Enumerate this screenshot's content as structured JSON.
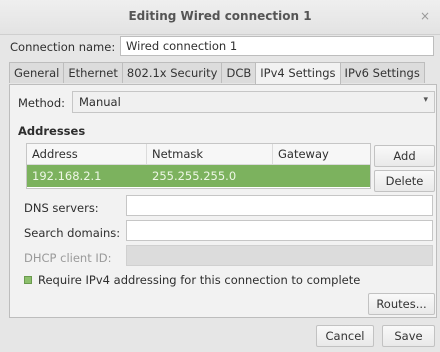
{
  "window": {
    "title": "Editing Wired connection 1",
    "close_glyph": "×"
  },
  "connection": {
    "label": "Connection name:",
    "value": "Wired connection 1"
  },
  "tabs": [
    {
      "label": "General",
      "active": false
    },
    {
      "label": "Ethernet",
      "active": false
    },
    {
      "label": "802.1x Security",
      "active": false
    },
    {
      "label": "DCB",
      "active": false
    },
    {
      "label": "IPv4 Settings",
      "active": true
    },
    {
      "label": "IPv6 Settings",
      "active": false
    }
  ],
  "method": {
    "label": "Method:",
    "value": "Manual",
    "arrow": "▾"
  },
  "addresses": {
    "heading": "Addresses",
    "columns": [
      "Address",
      "Netmask",
      "Gateway"
    ],
    "rows": [
      {
        "address": "192.168.2.1",
        "netmask": "255.255.255.0",
        "gateway": ""
      }
    ],
    "add_label": "Add",
    "delete_label": "Delete"
  },
  "fields": {
    "dns_label": "DNS servers:",
    "search_label": "Search domains:",
    "dhcp_label": "DHCP client ID:"
  },
  "require": {
    "label": "Require IPv4 addressing for this connection to complete",
    "checked": true
  },
  "routes_label": "Routes...",
  "footer": {
    "cancel_label": "Cancel",
    "save_label": "Save"
  },
  "colors": {
    "selection": "#7cb25e",
    "background": "#e6e6e6"
  }
}
